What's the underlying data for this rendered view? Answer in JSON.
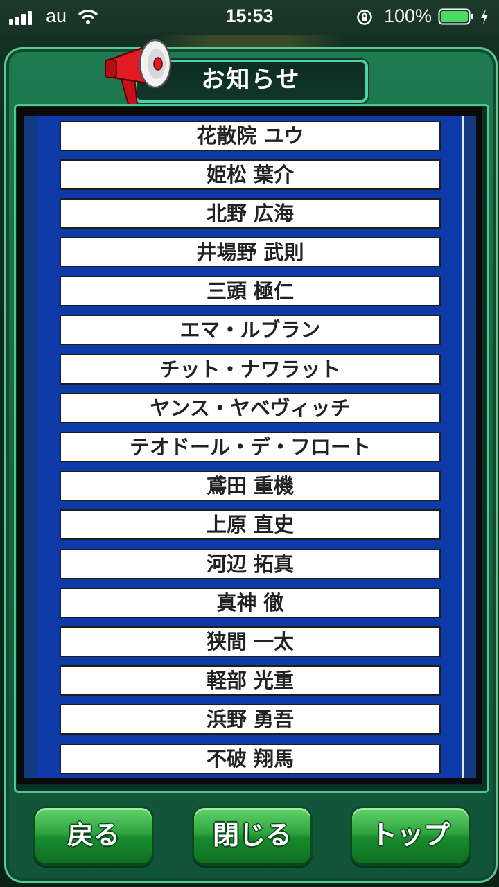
{
  "status_bar": {
    "carrier": "au",
    "time": "15:53",
    "battery_percent": "100%",
    "battery_level": 1.0
  },
  "header": {
    "title": "お知らせ",
    "icon": "megaphone-icon"
  },
  "list": {
    "items": [
      "花散院 ユウ",
      "姫松 葉介",
      "北野 広海",
      "井場野 武則",
      "三頭 極仁",
      "エマ・ルブラン",
      "チット・ナワラット",
      "ヤンス・ヤベヴィッチ",
      "テオドール・デ・フロート",
      "鳶田 重機",
      "上原 直史",
      "河辺 拓真",
      "真神 徹",
      "狭間 一太",
      "軽部 光重",
      "浜野 勇吾",
      "不破 翔馬"
    ]
  },
  "footer": {
    "back_label": "戻る",
    "close_label": "閉じる",
    "top_label": "トップ"
  },
  "colors": {
    "panel_green": "#1f7a4f",
    "list_blue": "#0d3aa6",
    "button_green": "#2fa53f",
    "title_border": "#4fd3a5"
  }
}
